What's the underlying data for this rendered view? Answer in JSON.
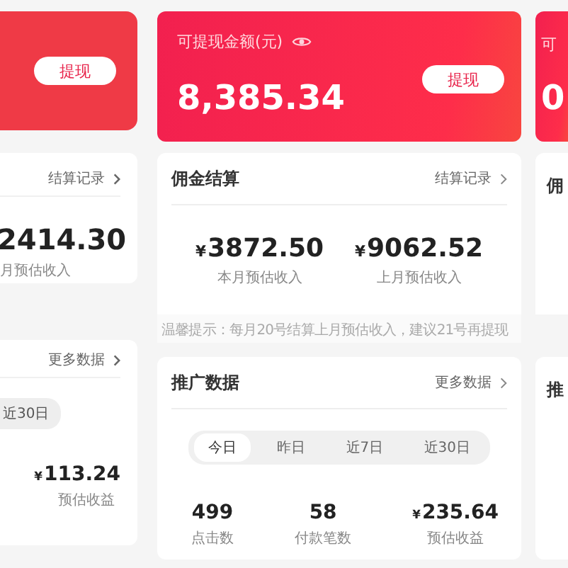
{
  "left_card": {
    "withdraw_button": "提现",
    "settlement_link": "结算记录",
    "amount": "2414.30",
    "amount_label": "月预估收入",
    "more_link": "更多数据",
    "range_tab": {
      "label": "近30日",
      "selected": false
    },
    "earnings": {
      "currency": "¥",
      "value": "113.24"
    },
    "earnings_label": "预估收益"
  },
  "center_card": {
    "balance_label": "可提现金额(元)",
    "balance": "8,385.34",
    "withdraw_button": "提现",
    "commission": {
      "title": "佣金结算",
      "link": "结算记录",
      "amounts": [
        {
          "currency": "¥",
          "value": "3872.50",
          "label": "本月预估收入"
        },
        {
          "currency": "¥",
          "value": "9062.52",
          "label": "上月预估收入"
        }
      ],
      "note": "温馨提示：每月20号结算上月预估收入，建议21号再提现"
    },
    "promotion": {
      "title": "推广数据",
      "link": "更多数据",
      "ranges": [
        {
          "label": "今日",
          "selected": true
        },
        {
          "label": "昨日",
          "selected": false
        },
        {
          "label": "近7日",
          "selected": false
        },
        {
          "label": "近30日",
          "selected": false
        }
      ],
      "stats": [
        {
          "value": "499",
          "label": "点击数"
        },
        {
          "value": "58",
          "label": "付款笔数"
        },
        {
          "currency": "¥",
          "value": "235.64",
          "label": "预估收益"
        }
      ]
    }
  },
  "right_card": {
    "balance_label": "可",
    "balance": "0",
    "commission_title": "佣",
    "promo_title": "推"
  }
}
